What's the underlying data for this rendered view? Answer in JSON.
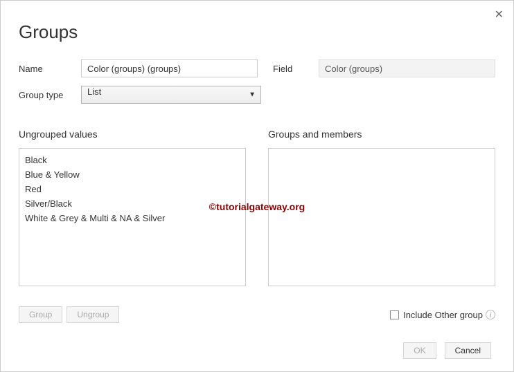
{
  "dialog": {
    "title": "Groups",
    "labels": {
      "name": "Name",
      "field": "Field",
      "groupType": "Group type",
      "ungroupedValues": "Ungrouped values",
      "groupsAndMembers": "Groups and members",
      "includeOther": "Include Other group"
    },
    "inputs": {
      "name": "Color (groups) (groups)",
      "field": "Color (groups)",
      "groupType": "List"
    },
    "ungroupedValues": [
      "Black",
      "Blue & Yellow",
      "Red",
      "Silver/Black",
      "White & Grey & Multi & NA & Silver"
    ],
    "groupsAndMembers": [],
    "buttons": {
      "group": "Group",
      "ungroup": "Ungroup",
      "ok": "OK",
      "cancel": "Cancel"
    },
    "includeOtherChecked": false
  },
  "watermark": "©tutorialgateway.org"
}
